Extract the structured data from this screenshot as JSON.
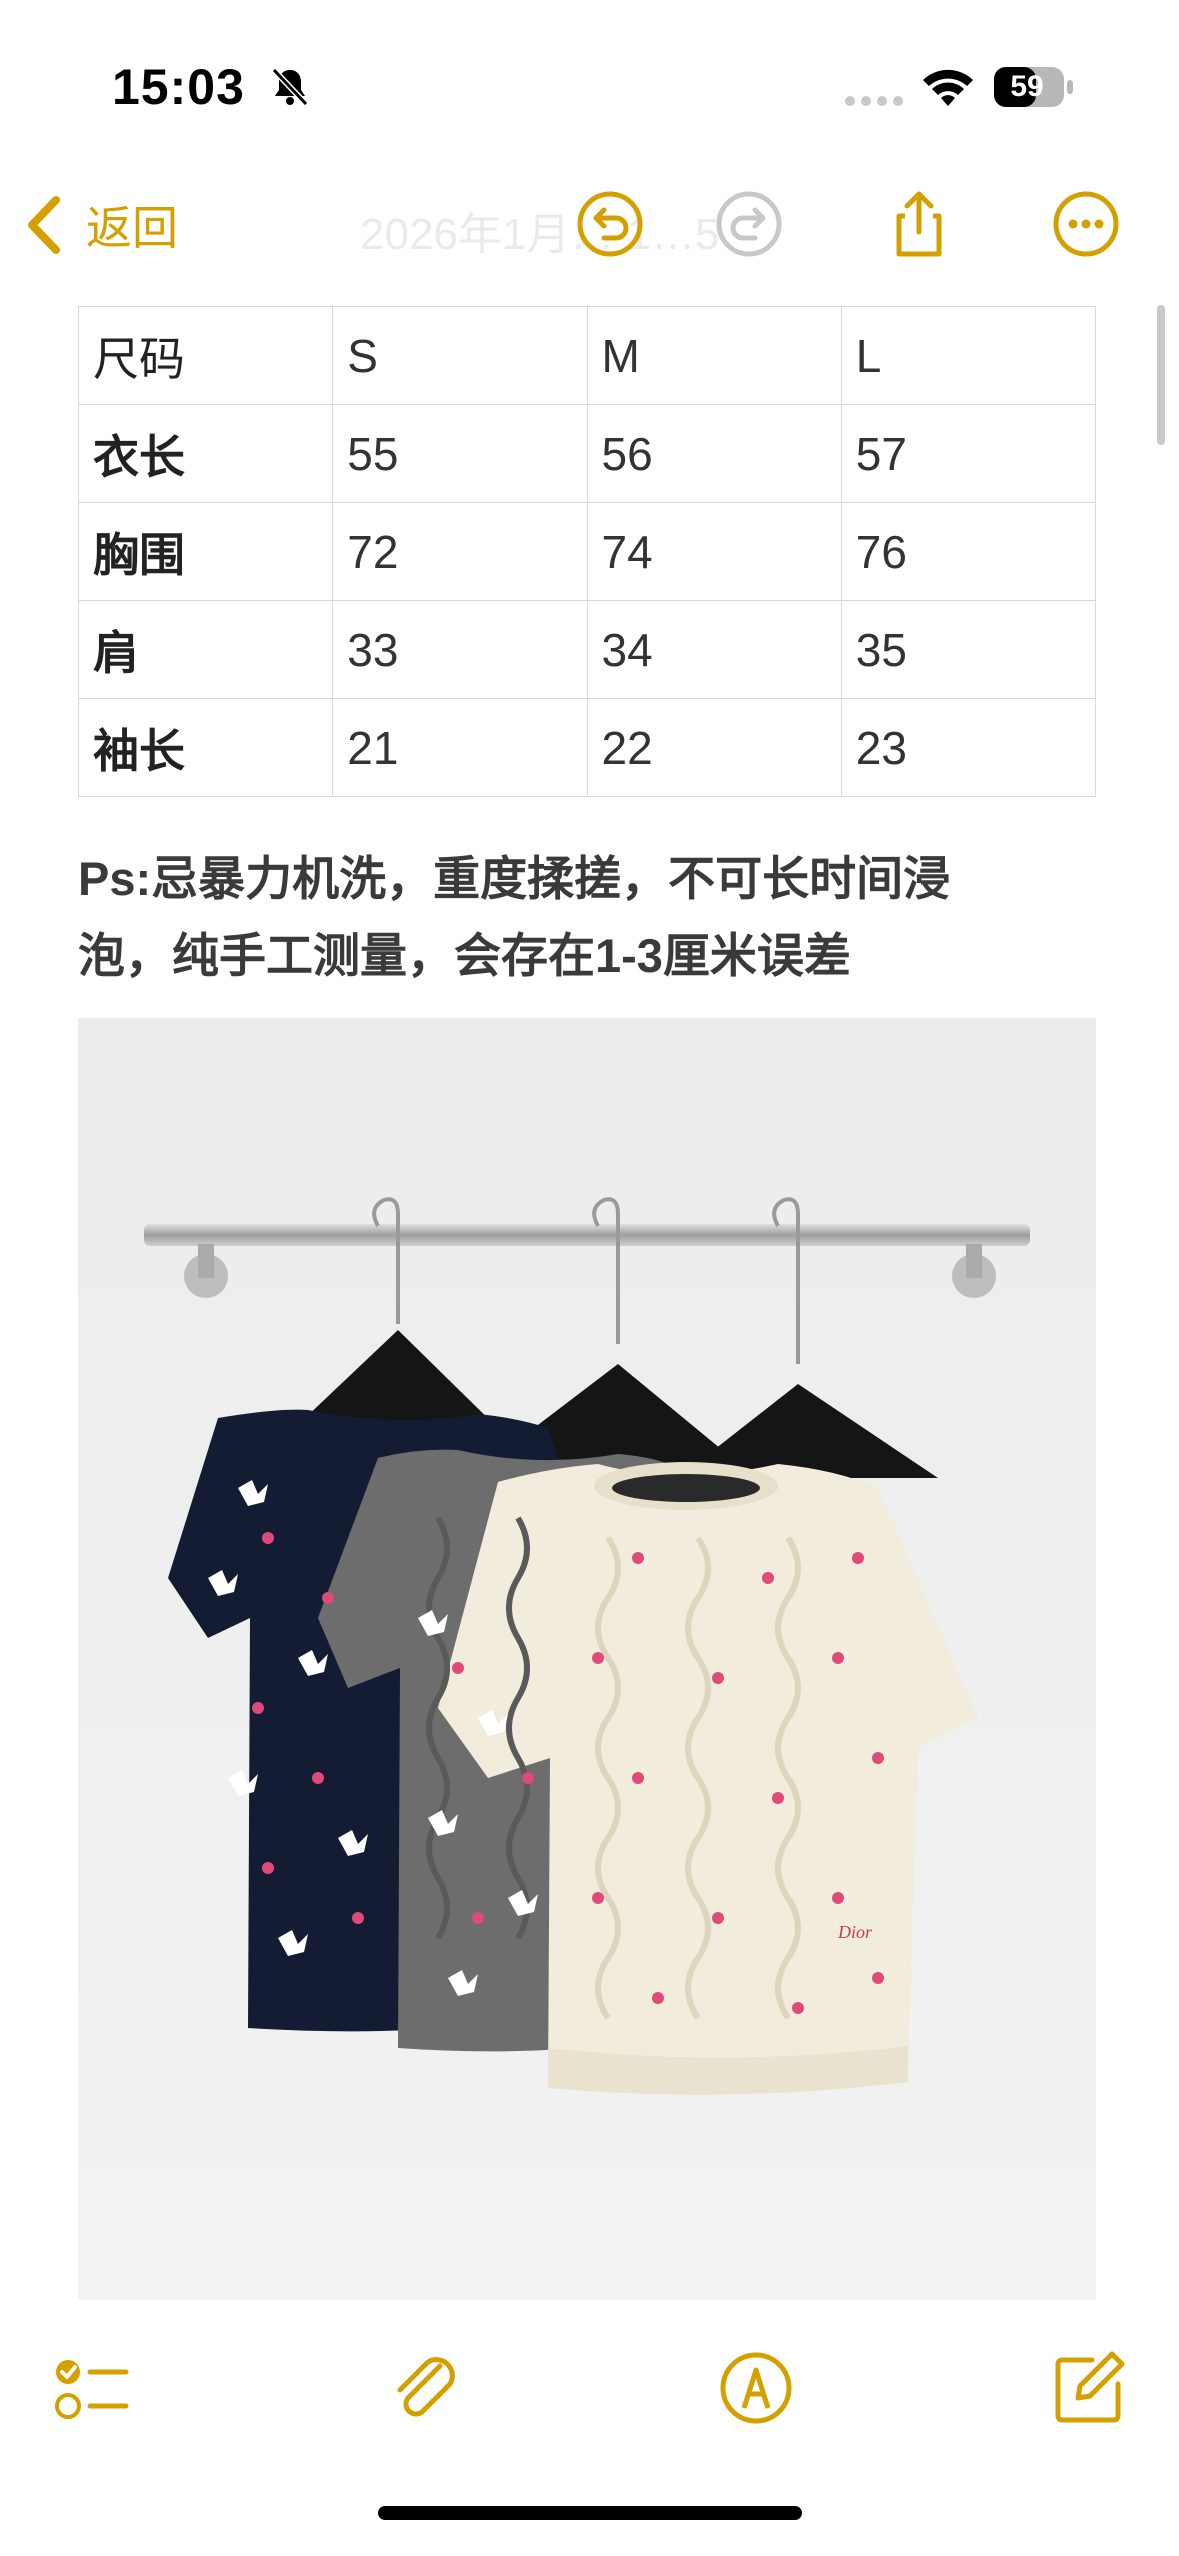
{
  "status": {
    "time": "15:03",
    "battery": "59",
    "icons": [
      "bell-slash-icon",
      "signal-dots-icon",
      "wifi-icon",
      "battery-icon"
    ]
  },
  "nav": {
    "back_label": "返回",
    "ghost_date": "2026年1月… 1…5",
    "icons": [
      "chevron-left-icon",
      "undo-icon",
      "redo-icon",
      "share-icon",
      "more-icon"
    ],
    "accent": "#d4a000"
  },
  "size_table": {
    "header": [
      "尺码",
      "S",
      "M",
      "L"
    ],
    "rows": [
      [
        "衣长",
        "55",
        "56",
        "57"
      ],
      [
        "胸围",
        "72",
        "74",
        "76"
      ],
      [
        "肩",
        "33",
        "34",
        "35"
      ],
      [
        "袖长",
        "21",
        "22",
        "23"
      ]
    ]
  },
  "note": {
    "line1": "Ps:忌暴力机洗，重度揉搓，不可长时间浸",
    "line2": "泡，纯手工测量，会存在1-3厘米误差"
  },
  "photo": {
    "icon": "product-photo-sweaters",
    "watermark": "Dior"
  },
  "toolbar": {
    "icons": [
      "checklist-icon",
      "paperclip-icon",
      "markup-pen-icon",
      "compose-icon"
    ]
  }
}
